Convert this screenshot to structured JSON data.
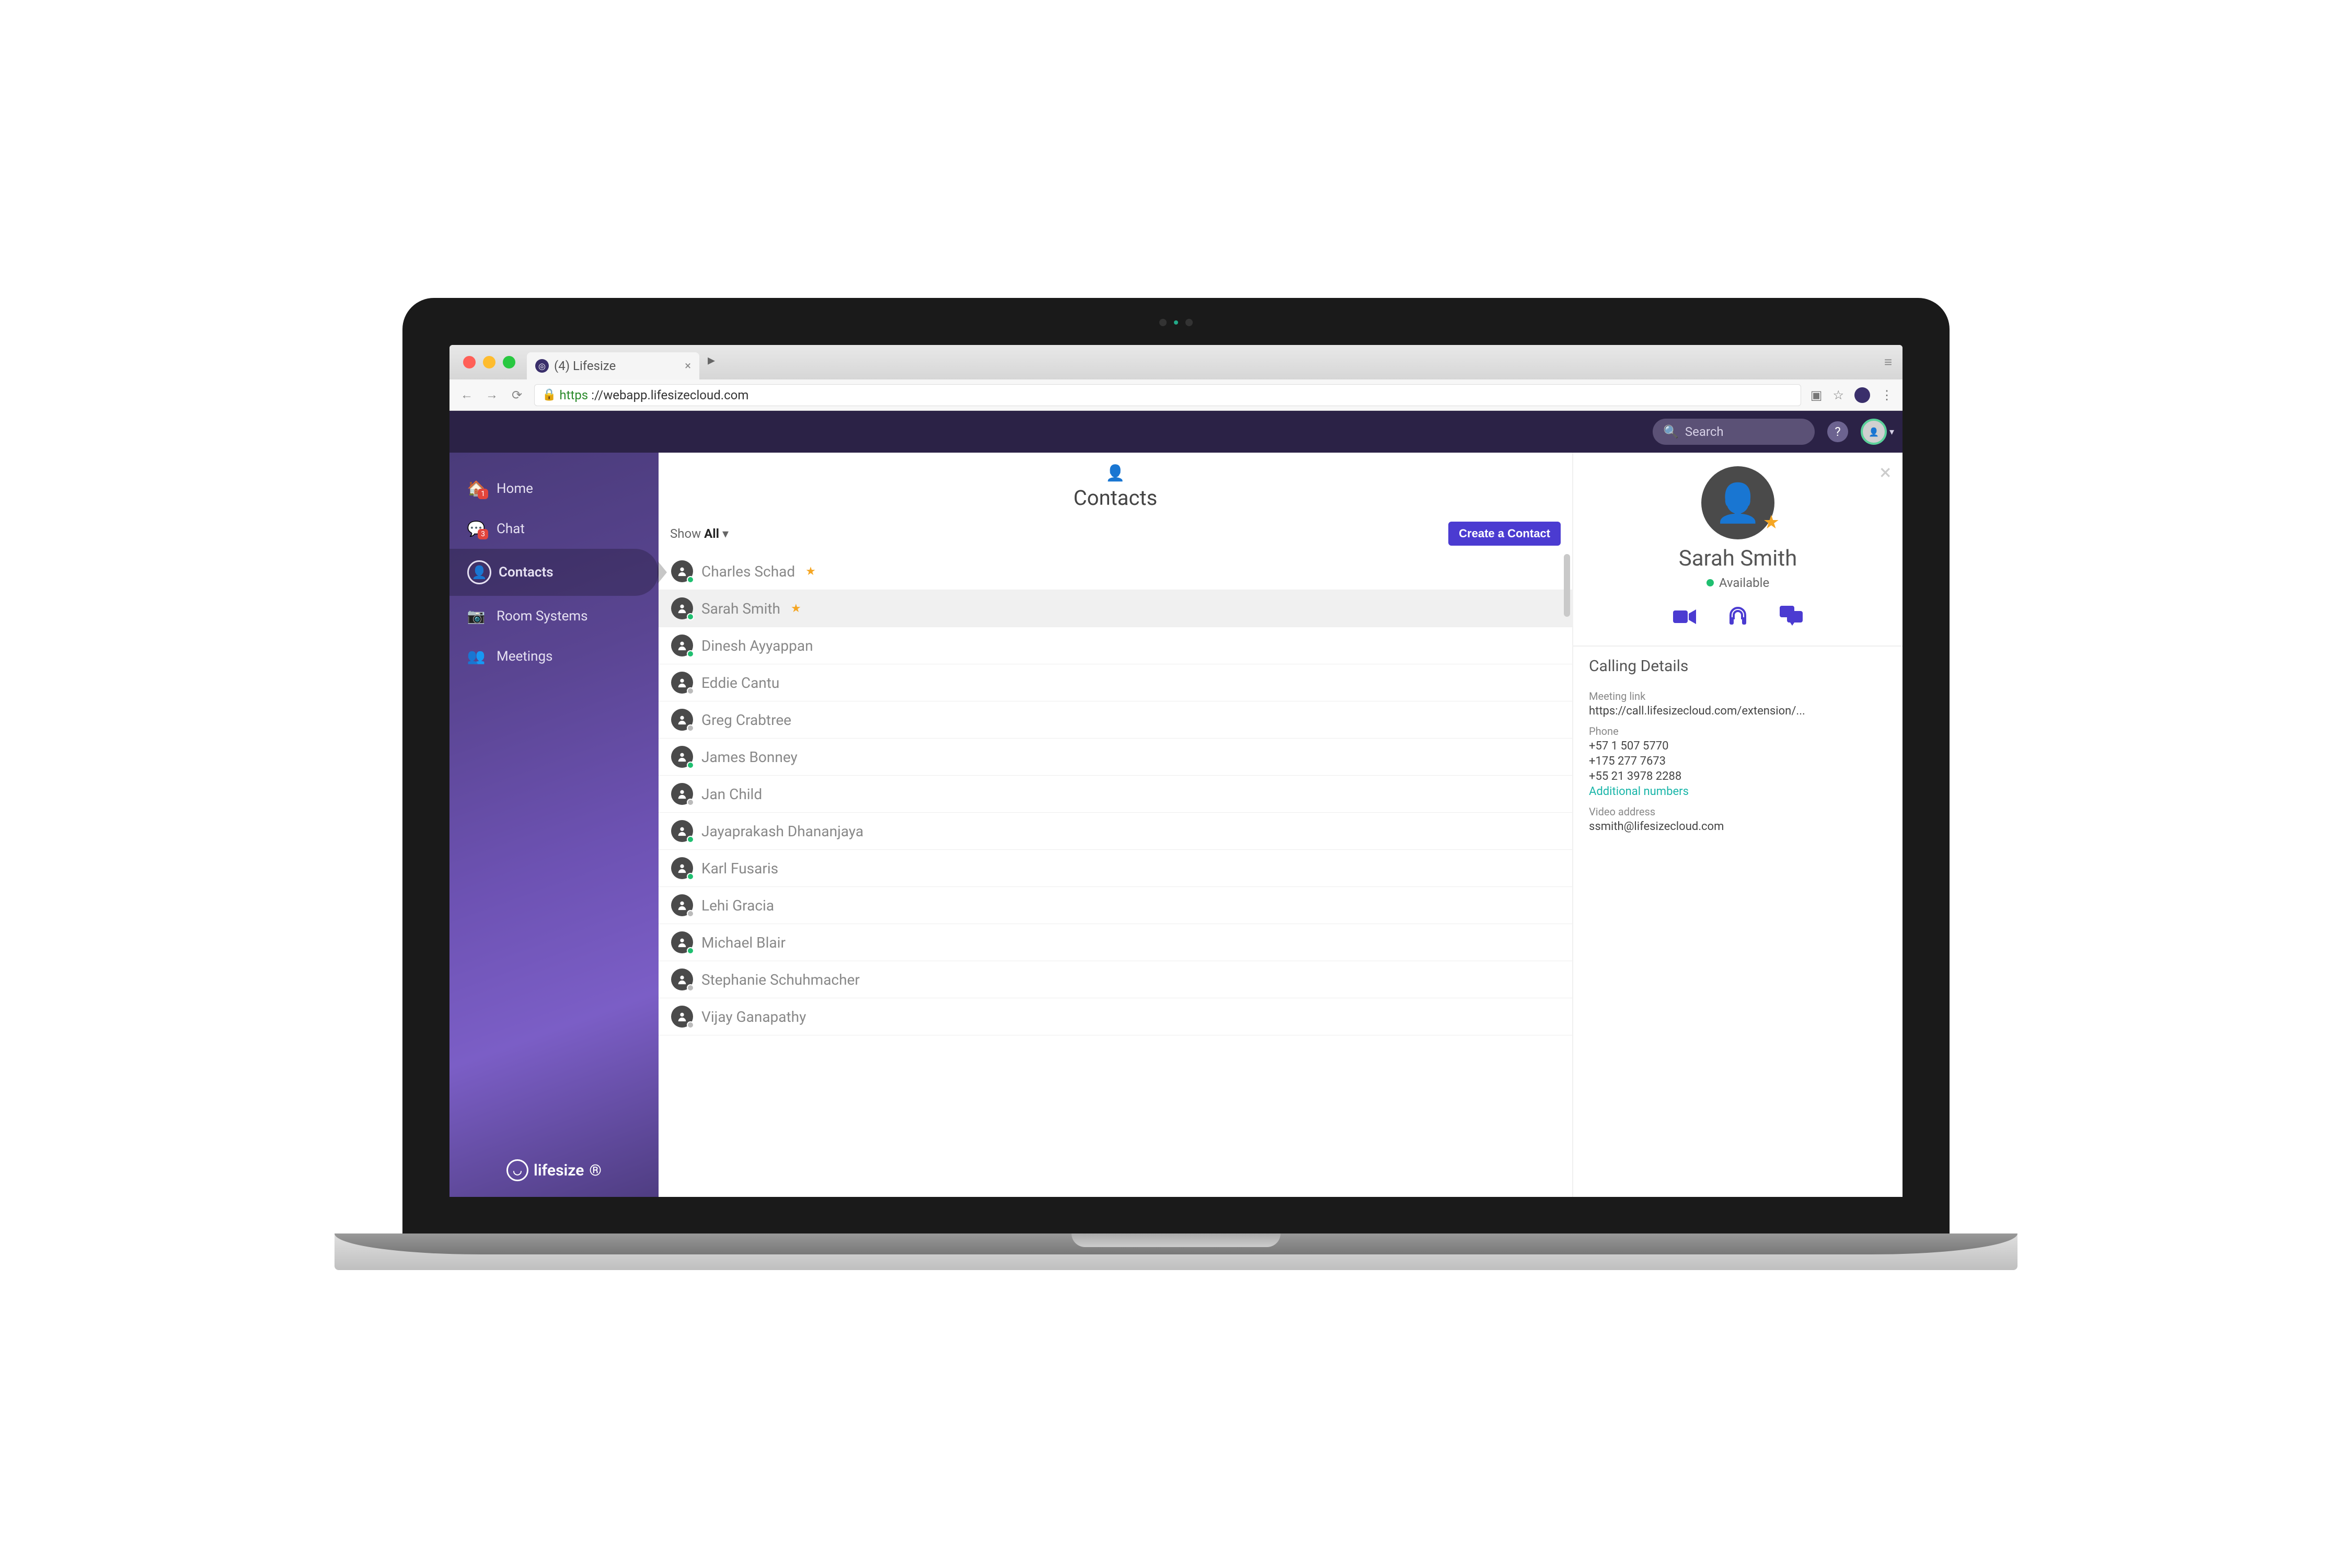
{
  "browser": {
    "tab_title": "(4) Lifesize",
    "url_protocol": "https",
    "url_host": "://webapp.lifesizecloud.com"
  },
  "header": {
    "search_placeholder": "Search"
  },
  "sidebar": {
    "items": [
      {
        "label": "Home",
        "icon": "home",
        "badge": "1"
      },
      {
        "label": "Chat",
        "icon": "chat",
        "badge": "3"
      },
      {
        "label": "Contacts",
        "icon": "contact",
        "active": true
      },
      {
        "label": "Room Systems",
        "icon": "room"
      },
      {
        "label": "Meetings",
        "icon": "meetings"
      }
    ],
    "brand": "lifesize"
  },
  "contacts": {
    "title": "Contacts",
    "filter_prefix": "Show",
    "filter_value": "All",
    "create_label": "Create a Contact",
    "list": [
      {
        "name": "Charles Schad",
        "presence": "green",
        "star": true
      },
      {
        "name": "Sarah Smith",
        "presence": "green",
        "star": true,
        "selected": true
      },
      {
        "name": "Dinesh Ayyappan",
        "presence": "green"
      },
      {
        "name": "Eddie Cantu",
        "presence": "gray"
      },
      {
        "name": "Greg Crabtree",
        "presence": "gray"
      },
      {
        "name": "James Bonney",
        "presence": "green"
      },
      {
        "name": "Jan Child",
        "presence": "gray"
      },
      {
        "name": "Jayaprakash Dhananjaya",
        "presence": "green"
      },
      {
        "name": "Karl Fusaris",
        "presence": "green"
      },
      {
        "name": "Lehi Gracia",
        "presence": "gray"
      },
      {
        "name": "Michael Blair",
        "presence": "green"
      },
      {
        "name": "Stephanie Schuhmacher",
        "presence": "gray"
      },
      {
        "name": "Vijay Ganapathy",
        "presence": "gray"
      }
    ]
  },
  "detail": {
    "name": "Sarah Smith",
    "presence_label": "Available",
    "section_title": "Calling Details",
    "meeting_link_label": "Meeting link",
    "meeting_link": "https://call.lifesizecloud.com/extension/...",
    "phone_label": "Phone",
    "phones": [
      "+57 1 507 5770",
      "+175 277 7673",
      "+55 21 3978 2288"
    ],
    "additional_numbers_label": "Additional numbers",
    "video_address_label": "Video address",
    "video_address": "ssmith@lifesizecloud.com"
  }
}
